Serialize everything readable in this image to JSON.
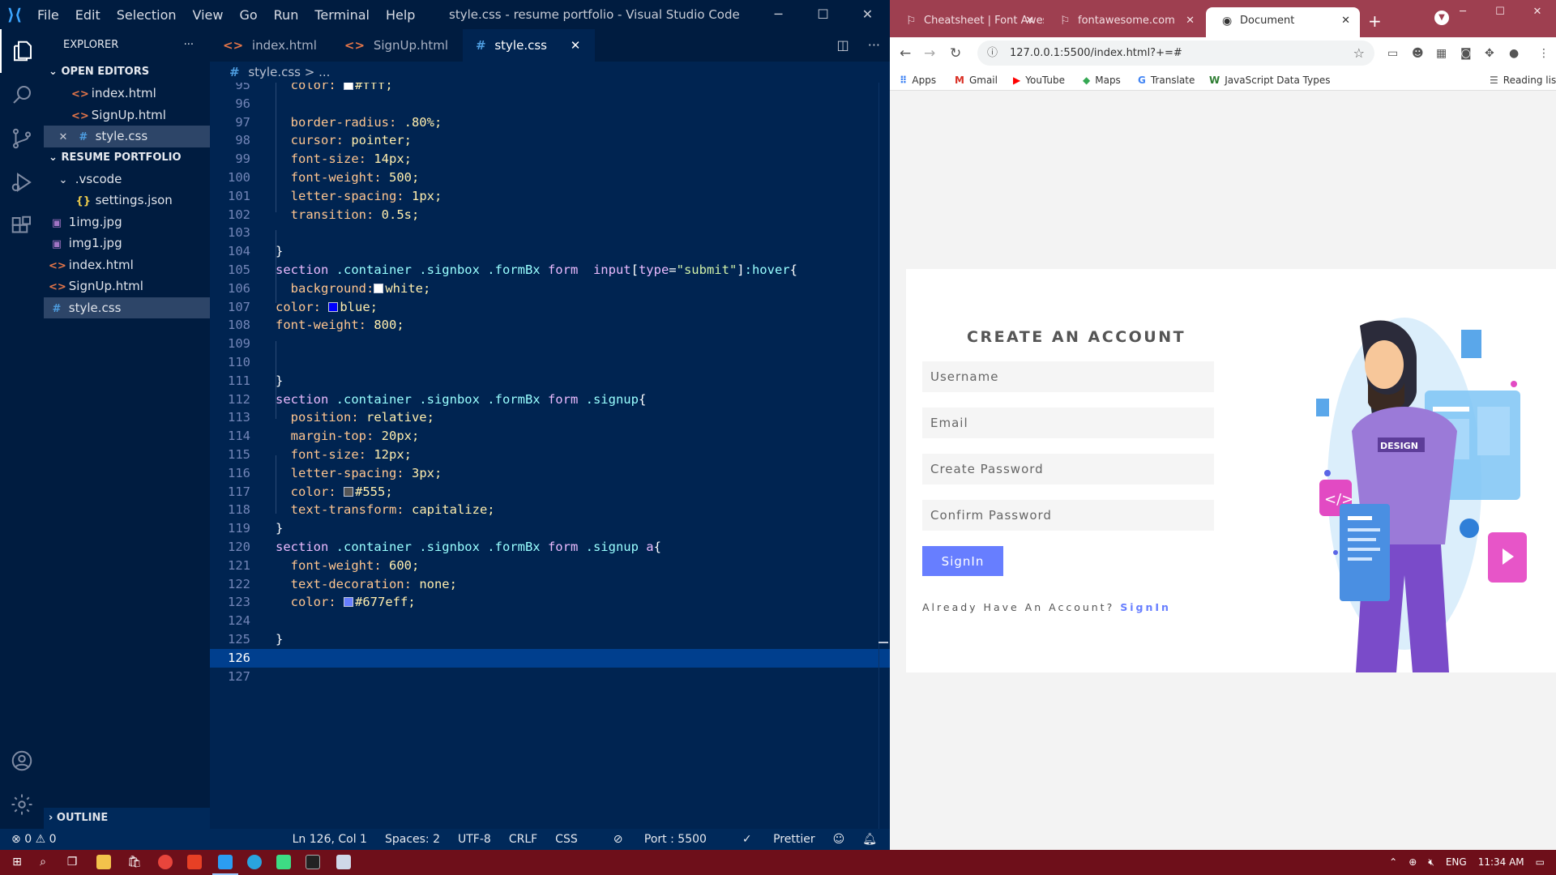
{
  "vscode": {
    "menu": [
      "File",
      "Edit",
      "Selection",
      "View",
      "Go",
      "Run",
      "Terminal",
      "Help"
    ],
    "window_title": "style.css - resume portfolio - Visual Studio Code",
    "explorer": {
      "title": "EXPLORER",
      "open_editors_label": "OPEN EDITORS",
      "open_editors": [
        {
          "icon": "<>",
          "name": "index.html",
          "type": "html"
        },
        {
          "icon": "<>",
          "name": "SignUp.html",
          "type": "html"
        },
        {
          "icon": "#",
          "name": "style.css",
          "type": "css"
        }
      ],
      "project_label": "RESUME PORTFOLIO",
      "folder": ".vscode",
      "files": [
        {
          "icon": "{}",
          "name": "settings.json",
          "type": "json",
          "indent": 2
        },
        {
          "icon": "▣",
          "name": "1img.jpg",
          "type": "img",
          "indent": 1
        },
        {
          "icon": "▣",
          "name": "img1.jpg",
          "type": "img",
          "indent": 1
        },
        {
          "icon": "<>",
          "name": "index.html",
          "type": "html",
          "indent": 1
        },
        {
          "icon": "<>",
          "name": "SignUp.html",
          "type": "html",
          "indent": 1
        },
        {
          "icon": "#",
          "name": "style.css",
          "type": "css",
          "indent": 1
        }
      ],
      "outline_label": "OUTLINE"
    },
    "tabs": [
      {
        "icon": "<>",
        "label": "index.html",
        "active": false
      },
      {
        "icon": "<>",
        "label": "SignUp.html",
        "active": false
      },
      {
        "icon": "#",
        "label": "style.css",
        "active": true
      }
    ],
    "breadcrumb": {
      "file": "style.css",
      "rest": "> ..."
    },
    "code_lines": [
      {
        "n": "95",
        "s": [
          [
            "pr",
            "  color: "
          ],
          [
            "sw",
            "#ffffff"
          ],
          [
            "vl",
            "#fff;"
          ]
        ]
      },
      {
        "n": "96",
        "s": []
      },
      {
        "n": "97",
        "s": [
          [
            "pr",
            "  border-radius: "
          ],
          [
            "vl",
            ".80%;"
          ]
        ]
      },
      {
        "n": "98",
        "s": [
          [
            "pr",
            "  cursor: "
          ],
          [
            "vl",
            "pointer;"
          ]
        ]
      },
      {
        "n": "99",
        "s": [
          [
            "pr",
            "  font-size: "
          ],
          [
            "vl",
            "14px;"
          ]
        ]
      },
      {
        "n": "100",
        "s": [
          [
            "pr",
            "  font-weight: "
          ],
          [
            "vl",
            "500;"
          ]
        ]
      },
      {
        "n": "101",
        "s": [
          [
            "pr",
            "  letter-spacing: "
          ],
          [
            "vl",
            "1px;"
          ]
        ]
      },
      {
        "n": "102",
        "s": [
          [
            "pr",
            "  transition: "
          ],
          [
            "vl",
            "0.5s;"
          ]
        ]
      },
      {
        "n": "103",
        "s": []
      },
      {
        "n": "104",
        "s": [
          [
            "br",
            "}"
          ]
        ]
      },
      {
        "n": "105",
        "s": [
          [
            "sel-t",
            "section "
          ],
          [
            "sel-c",
            ".container .signbox .formBx "
          ],
          [
            "sel-t",
            "form  input"
          ],
          [
            "br",
            "["
          ],
          [
            "sel-t",
            "type"
          ],
          [
            "br",
            "="
          ],
          [
            "str",
            "\"submit\""
          ],
          [
            "br",
            "]"
          ],
          [
            "sel-c",
            ":hover"
          ],
          [
            "br",
            "{"
          ]
        ]
      },
      {
        "n": "106",
        "s": [
          [
            "pr",
            "  background:"
          ],
          [
            "sw",
            "#ffffff"
          ],
          [
            "vl",
            "white;"
          ]
        ]
      },
      {
        "n": "107",
        "s": [
          [
            "pr",
            "color: "
          ],
          [
            "sw",
            "#0000ff"
          ],
          [
            "vl",
            "blue;"
          ]
        ]
      },
      {
        "n": "108",
        "s": [
          [
            "pr",
            "font-weight: "
          ],
          [
            "vl",
            "800;"
          ]
        ]
      },
      {
        "n": "109",
        "s": []
      },
      {
        "n": "110",
        "s": []
      },
      {
        "n": "111",
        "s": [
          [
            "br",
            "}"
          ]
        ]
      },
      {
        "n": "112",
        "s": [
          [
            "sel-t",
            "section "
          ],
          [
            "sel-c",
            ".container .signbox .formBx "
          ],
          [
            "sel-t",
            "form "
          ],
          [
            "sel-c",
            ".signup"
          ],
          [
            "br",
            "{"
          ]
        ]
      },
      {
        "n": "113",
        "s": [
          [
            "pr",
            "  position: "
          ],
          [
            "vl",
            "relative;"
          ]
        ]
      },
      {
        "n": "114",
        "s": [
          [
            "pr",
            "  margin-top: "
          ],
          [
            "vl",
            "20px;"
          ]
        ]
      },
      {
        "n": "115",
        "s": [
          [
            "pr",
            "  font-size: "
          ],
          [
            "vl",
            "12px;"
          ]
        ]
      },
      {
        "n": "116",
        "s": [
          [
            "pr",
            "  letter-spacing: "
          ],
          [
            "vl",
            "3px;"
          ]
        ]
      },
      {
        "n": "117",
        "s": [
          [
            "pr",
            "  color: "
          ],
          [
            "sw",
            "#555555"
          ],
          [
            "vl",
            "#555;"
          ]
        ]
      },
      {
        "n": "118",
        "s": [
          [
            "pr",
            "  text-transform: "
          ],
          [
            "vl",
            "capitalize;"
          ]
        ]
      },
      {
        "n": "119",
        "s": [
          [
            "br",
            "}"
          ]
        ]
      },
      {
        "n": "120",
        "s": [
          [
            "sel-t",
            "section "
          ],
          [
            "sel-c",
            ".container .signbox .formBx "
          ],
          [
            "sel-t",
            "form "
          ],
          [
            "sel-c",
            ".signup "
          ],
          [
            "sel-t",
            "a"
          ],
          [
            "br",
            "{"
          ]
        ]
      },
      {
        "n": "121",
        "s": [
          [
            "pr",
            "  font-weight: "
          ],
          [
            "vl",
            "600;"
          ]
        ]
      },
      {
        "n": "122",
        "s": [
          [
            "pr",
            "  text-decoration: "
          ],
          [
            "vl",
            "none;"
          ]
        ]
      },
      {
        "n": "123",
        "s": [
          [
            "pr",
            "  color: "
          ],
          [
            "sw",
            "#677eff"
          ],
          [
            "vl",
            "#677eff;"
          ]
        ]
      },
      {
        "n": "124",
        "s": []
      },
      {
        "n": "125",
        "s": [
          [
            "br",
            "}"
          ]
        ]
      },
      {
        "n": "126",
        "s": [],
        "current": true
      },
      {
        "n": "127",
        "s": []
      }
    ],
    "status": {
      "errors": "0",
      "warnings": "0",
      "position": "Ln 126, Col 1",
      "spaces": "Spaces: 2",
      "encoding": "UTF-8",
      "eol": "CRLF",
      "language": "CSS",
      "port": "Port : 5500",
      "prettier": "Prettier"
    }
  },
  "chrome": {
    "tabs": [
      {
        "label": "Cheatsheet | Font Awes",
        "active": false
      },
      {
        "label": "fontawesome.com",
        "active": false
      },
      {
        "label": "Document",
        "active": true
      }
    ],
    "url": "127.0.0.1:5500/index.html?+=#",
    "bookmarks": [
      "Apps",
      "Gmail",
      "YouTube",
      "Maps",
      "Translate",
      "JavaScript Data Types",
      "Reading list"
    ]
  },
  "page": {
    "title": "CREATE AN ACCOUNT",
    "fields": [
      {
        "placeholder": "Username"
      },
      {
        "placeholder": "Email"
      },
      {
        "placeholder": "Create Password"
      },
      {
        "placeholder": "Confirm Password"
      }
    ],
    "button": "SignIn",
    "signup_text": "Already Have An Account? ",
    "signup_link": "SignIn",
    "illustration_badge": "DESIGN",
    "accent": "#677eff"
  },
  "taskbar": {
    "lang": "ENG",
    "time": "11:34 AM"
  }
}
